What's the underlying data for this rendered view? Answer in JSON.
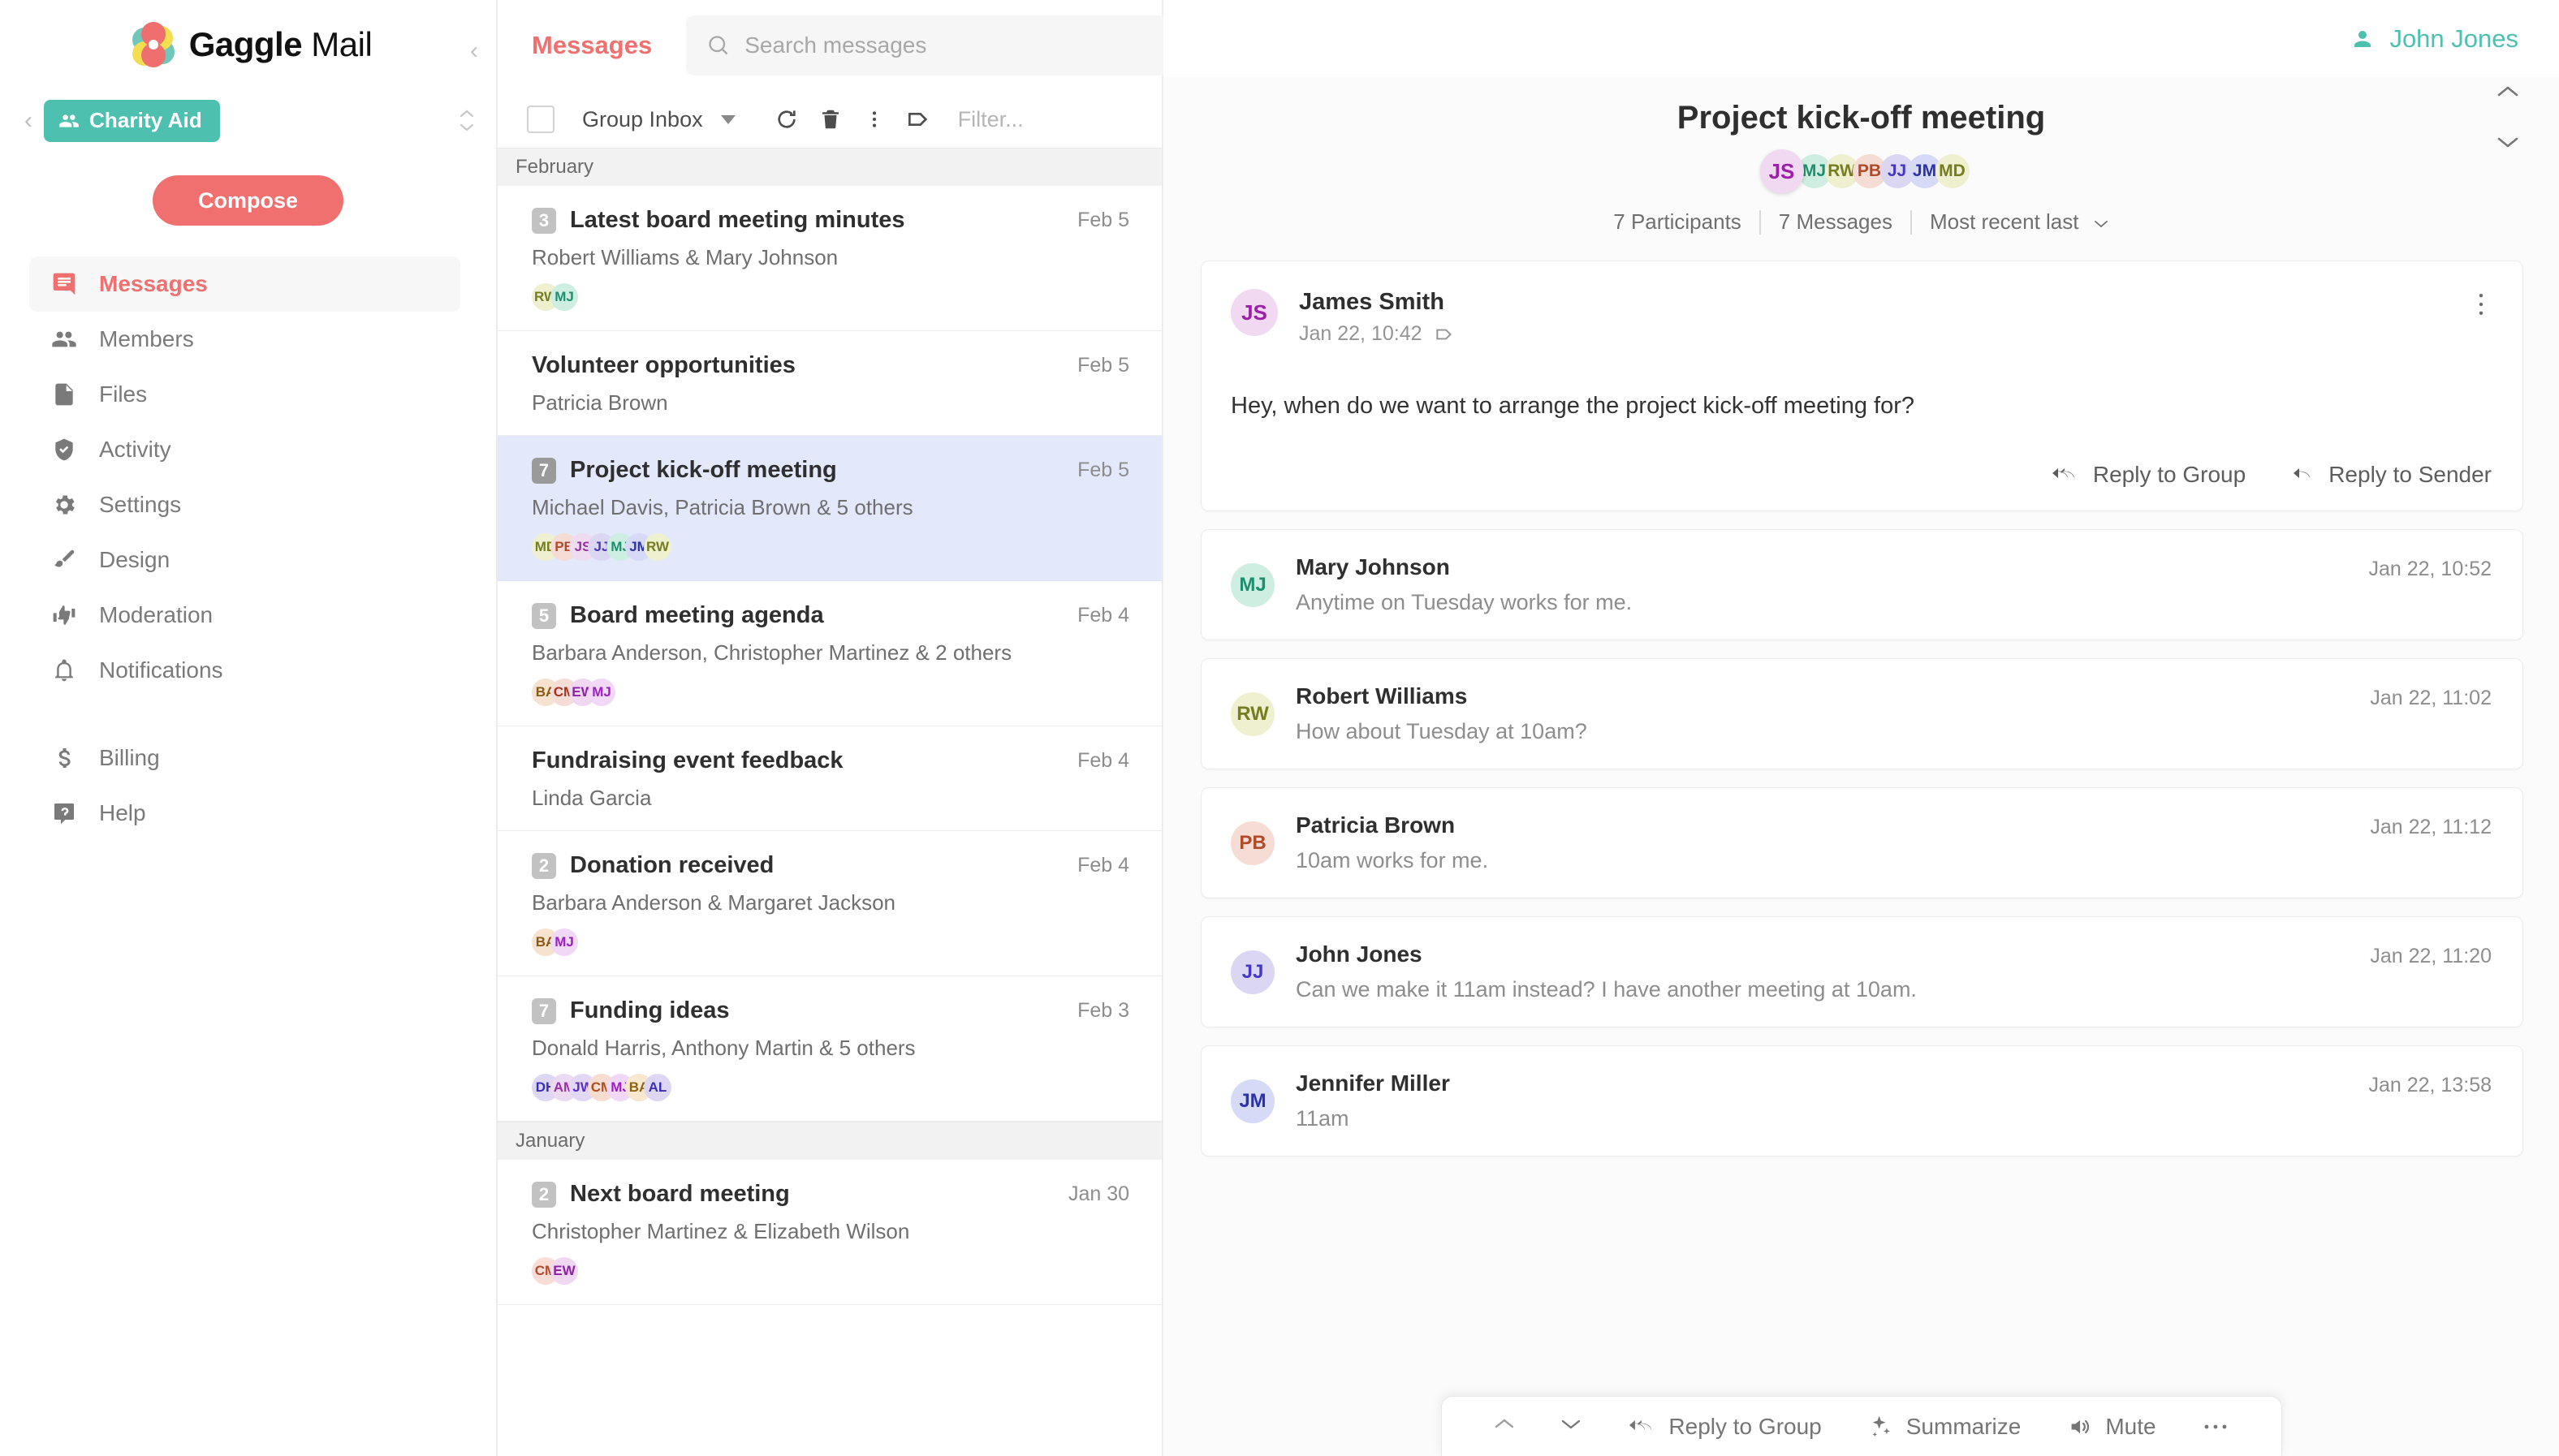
{
  "brand": {
    "name_bold": "Gaggle",
    "name_light": "Mail",
    "logo_icon": "gaggle-flower-logo",
    "accent_red": "#f07070",
    "accent_teal": "#4ec0b0"
  },
  "sidebar": {
    "collapse_icon": "chevron-left-icon",
    "group_back_icon": "chevron-left-icon",
    "group_name": "Charity Aid",
    "group_icon": "people-icon",
    "group_switch_icon": "chevron-up-down-icon",
    "compose_label": "Compose",
    "items": [
      {
        "label": "Messages",
        "icon": "message-icon",
        "active": true
      },
      {
        "label": "Members",
        "icon": "people-icon",
        "active": false
      },
      {
        "label": "Files",
        "icon": "file-icon",
        "active": false
      },
      {
        "label": "Activity",
        "icon": "shield-check-icon",
        "active": false
      },
      {
        "label": "Settings",
        "icon": "gear-icon",
        "active": false
      },
      {
        "label": "Design",
        "icon": "paintbrush-icon",
        "active": false
      },
      {
        "label": "Moderation",
        "icon": "thumbs-updown-icon",
        "active": false
      },
      {
        "label": "Notifications",
        "icon": "bell-icon",
        "active": false
      }
    ],
    "items_footer": [
      {
        "label": "Billing",
        "icon": "dollar-icon"
      },
      {
        "label": "Help",
        "icon": "help-icon"
      }
    ]
  },
  "list_header": {
    "tab_label": "Messages",
    "search_placeholder": "Search messages",
    "search_value": "",
    "search_icon": "search-icon"
  },
  "toolbar": {
    "select_all_icon": "checkbox-icon",
    "mailbox_label": "Group Inbox",
    "dropdown_icon": "chevron-down-icon",
    "refresh_icon": "refresh-icon",
    "delete_icon": "trash-icon",
    "more_icon": "more-vertical-icon",
    "tag_icon": "tag-icon",
    "filter_placeholder": "Filter..."
  },
  "threads": [
    {
      "type": "month",
      "label": "February"
    },
    {
      "type": "thread",
      "count": "3",
      "subject": "Latest board meeting minutes",
      "date": "Feb 5",
      "people": "Robert Williams & Mary Johnson",
      "selected": false,
      "chips": [
        {
          "initials": "RW",
          "bg": "#eef0cf",
          "fg": "#767d21"
        },
        {
          "initials": "MJ",
          "bg": "#cdeee0",
          "fg": "#1d8f6e"
        }
      ]
    },
    {
      "type": "thread",
      "count": "",
      "subject": "Volunteer opportunities",
      "date": "Feb 5",
      "people": "Patricia Brown",
      "selected": false,
      "chips": []
    },
    {
      "type": "thread",
      "count": "7",
      "subject": "Project kick-off meeting",
      "date": "Feb 5",
      "people": "Michael Davis, Patricia Brown & 5 others",
      "selected": true,
      "chips": [
        {
          "initials": "MD",
          "bg": "#eef0cf",
          "fg": "#767d21"
        },
        {
          "initials": "PB",
          "bg": "#f5dcd4",
          "fg": "#b14a28"
        },
        {
          "initials": "JS",
          "bg": "#f0dcf0",
          "fg": "#9b2fa8"
        },
        {
          "initials": "JJ",
          "bg": "#dbd7f3",
          "fg": "#4537c4"
        },
        {
          "initials": "MJ",
          "bg": "#cdeee0",
          "fg": "#1d8f6e"
        },
        {
          "initials": "JM",
          "bg": "#d6daf6",
          "fg": "#2b32ab"
        },
        {
          "initials": "RW",
          "bg": "#eef0cf",
          "fg": "#767d21"
        }
      ]
    },
    {
      "type": "thread",
      "count": "5",
      "subject": "Board meeting agenda",
      "date": "Feb 4",
      "people": "Barbara Anderson, Christopher Martinez & 2 others",
      "selected": false,
      "chips": [
        {
          "initials": "BA",
          "bg": "#f7e2cf",
          "fg": "#8a5a13"
        },
        {
          "initials": "CM",
          "bg": "#f6dcd7",
          "fg": "#a8321f"
        },
        {
          "initials": "EW",
          "bg": "#f0d8f2",
          "fg": "#8d22a8"
        },
        {
          "initials": "MJ",
          "bg": "#f0d8f6",
          "fg": "#9b1fc4"
        }
      ]
    },
    {
      "type": "thread",
      "count": "",
      "subject": "Fundraising event feedback",
      "date": "Feb 4",
      "people": "Linda Garcia",
      "selected": false,
      "chips": []
    },
    {
      "type": "thread",
      "count": "2",
      "subject": "Donation received",
      "date": "Feb 4",
      "people": "Barbara Anderson & Margaret Jackson",
      "selected": false,
      "chips": [
        {
          "initials": "BA",
          "bg": "#f7e2cf",
          "fg": "#8a5a13"
        },
        {
          "initials": "MJ",
          "bg": "#f0d8f6",
          "fg": "#9b1fc4"
        }
      ]
    },
    {
      "type": "thread",
      "count": "7",
      "subject": "Funding ideas",
      "date": "Feb 3",
      "people": "Donald Harris, Anthony Martin & 5 others",
      "selected": false,
      "chips": [
        {
          "initials": "DH",
          "bg": "#ddd7f3",
          "fg": "#3b2fb8"
        },
        {
          "initials": "AM",
          "bg": "#ecd9f2",
          "fg": "#9b2fa8"
        },
        {
          "initials": "JW",
          "bg": "#e2d7f5",
          "fg": "#5b2fc4"
        },
        {
          "initials": "CM",
          "bg": "#f7ddd0",
          "fg": "#b04a1f"
        },
        {
          "initials": "MJ",
          "bg": "#f0d8f6",
          "fg": "#9b1fc4"
        },
        {
          "initials": "BA",
          "bg": "#f7e8cf",
          "fg": "#8a6513"
        },
        {
          "initials": "AL",
          "bg": "#ddd7f3",
          "fg": "#3b2fb8"
        }
      ]
    },
    {
      "type": "month",
      "label": "January"
    },
    {
      "type": "thread",
      "count": "2",
      "subject": "Next board meeting",
      "date": "Jan 30",
      "people": "Christopher Martinez & Elizabeth Wilson",
      "selected": false,
      "chips": [
        {
          "initials": "CM",
          "bg": "#f7ddd6",
          "fg": "#b04a2f"
        },
        {
          "initials": "EW",
          "bg": "#f0d8f2",
          "fg": "#8d22a8"
        }
      ]
    }
  ],
  "topbar": {
    "user_name": "John Jones",
    "user_icon": "person-icon"
  },
  "conversation": {
    "title": "Project kick-off meeting",
    "collapse_up_icon": "chevron-up-icon",
    "collapse_down_icon": "chevron-down-icon",
    "avatars": [
      {
        "initials": "JS",
        "bg": "#f1d9f1",
        "fg": "#9b1fa8",
        "lead": true
      },
      {
        "initials": "MJ",
        "bg": "#cdeee0",
        "fg": "#1d8f6e",
        "lead": false
      },
      {
        "initials": "RW",
        "bg": "#eef0cf",
        "fg": "#767d21",
        "lead": false
      },
      {
        "initials": "PB",
        "bg": "#f5dcd4",
        "fg": "#b14a28",
        "lead": false
      },
      {
        "initials": "JJ",
        "bg": "#dbd7f3",
        "fg": "#4537c4",
        "lead": false
      },
      {
        "initials": "JM",
        "bg": "#d6daf6",
        "fg": "#2b32ab",
        "lead": false
      },
      {
        "initials": "MD",
        "bg": "#eef0cf",
        "fg": "#767d21",
        "lead": false
      }
    ],
    "participants_label": "7 Participants",
    "messages_label": "7 Messages",
    "sort_label": "Most recent last",
    "sort_icon": "chevron-down-icon",
    "messages": [
      {
        "expanded": true,
        "sender": "James Smith",
        "initials": "JS",
        "bg": "#f1d9f1",
        "fg": "#9b1fa8",
        "time": "Jan 22, 10:42",
        "tag_icon": "tag-icon",
        "kebab_icon": "more-vertical-icon",
        "body": "Hey, when do we want to arrange the project kick-off meeting for?",
        "reply_group_label": "Reply to Group",
        "reply_sender_label": "Reply to Sender",
        "reply_group_icon": "reply-all-icon",
        "reply_sender_icon": "reply-icon"
      },
      {
        "expanded": false,
        "sender": "Mary Johnson",
        "initials": "MJ",
        "bg": "#cdeee0",
        "fg": "#1d8f6e",
        "time": "Jan 22, 10:52",
        "preview": "Anytime on Tuesday works for me."
      },
      {
        "expanded": false,
        "sender": "Robert Williams",
        "initials": "RW",
        "bg": "#eef0cf",
        "fg": "#767d21",
        "time": "Jan 22, 11:02",
        "preview": "How about Tuesday at 10am?"
      },
      {
        "expanded": false,
        "sender": "Patricia Brown",
        "initials": "PB",
        "bg": "#f5dcd4",
        "fg": "#b14a28",
        "time": "Jan 22, 11:12",
        "preview": "10am works for me."
      },
      {
        "expanded": false,
        "sender": "John Jones",
        "initials": "JJ",
        "bg": "#dbd7f3",
        "fg": "#4537c4",
        "time": "Jan 22, 11:20",
        "preview": "Can we make it 11am instead? I have another meeting at 10am."
      },
      {
        "expanded": false,
        "sender": "Jennifer Miller",
        "initials": "JM",
        "bg": "#d6daf6",
        "fg": "#2b32ab",
        "time": "Jan 22, 13:58",
        "preview": "11am"
      }
    ]
  },
  "float_bar": {
    "prev_icon": "chevron-up-icon",
    "next_icon": "chevron-down-icon",
    "reply_group_label": "Reply to Group",
    "reply_group_icon": "reply-all-icon",
    "summarize_label": "Summarize",
    "summarize_icon": "sparkle-icon",
    "mute_label": "Mute",
    "mute_icon": "speaker-icon",
    "more_icon": "more-horizontal-icon"
  }
}
